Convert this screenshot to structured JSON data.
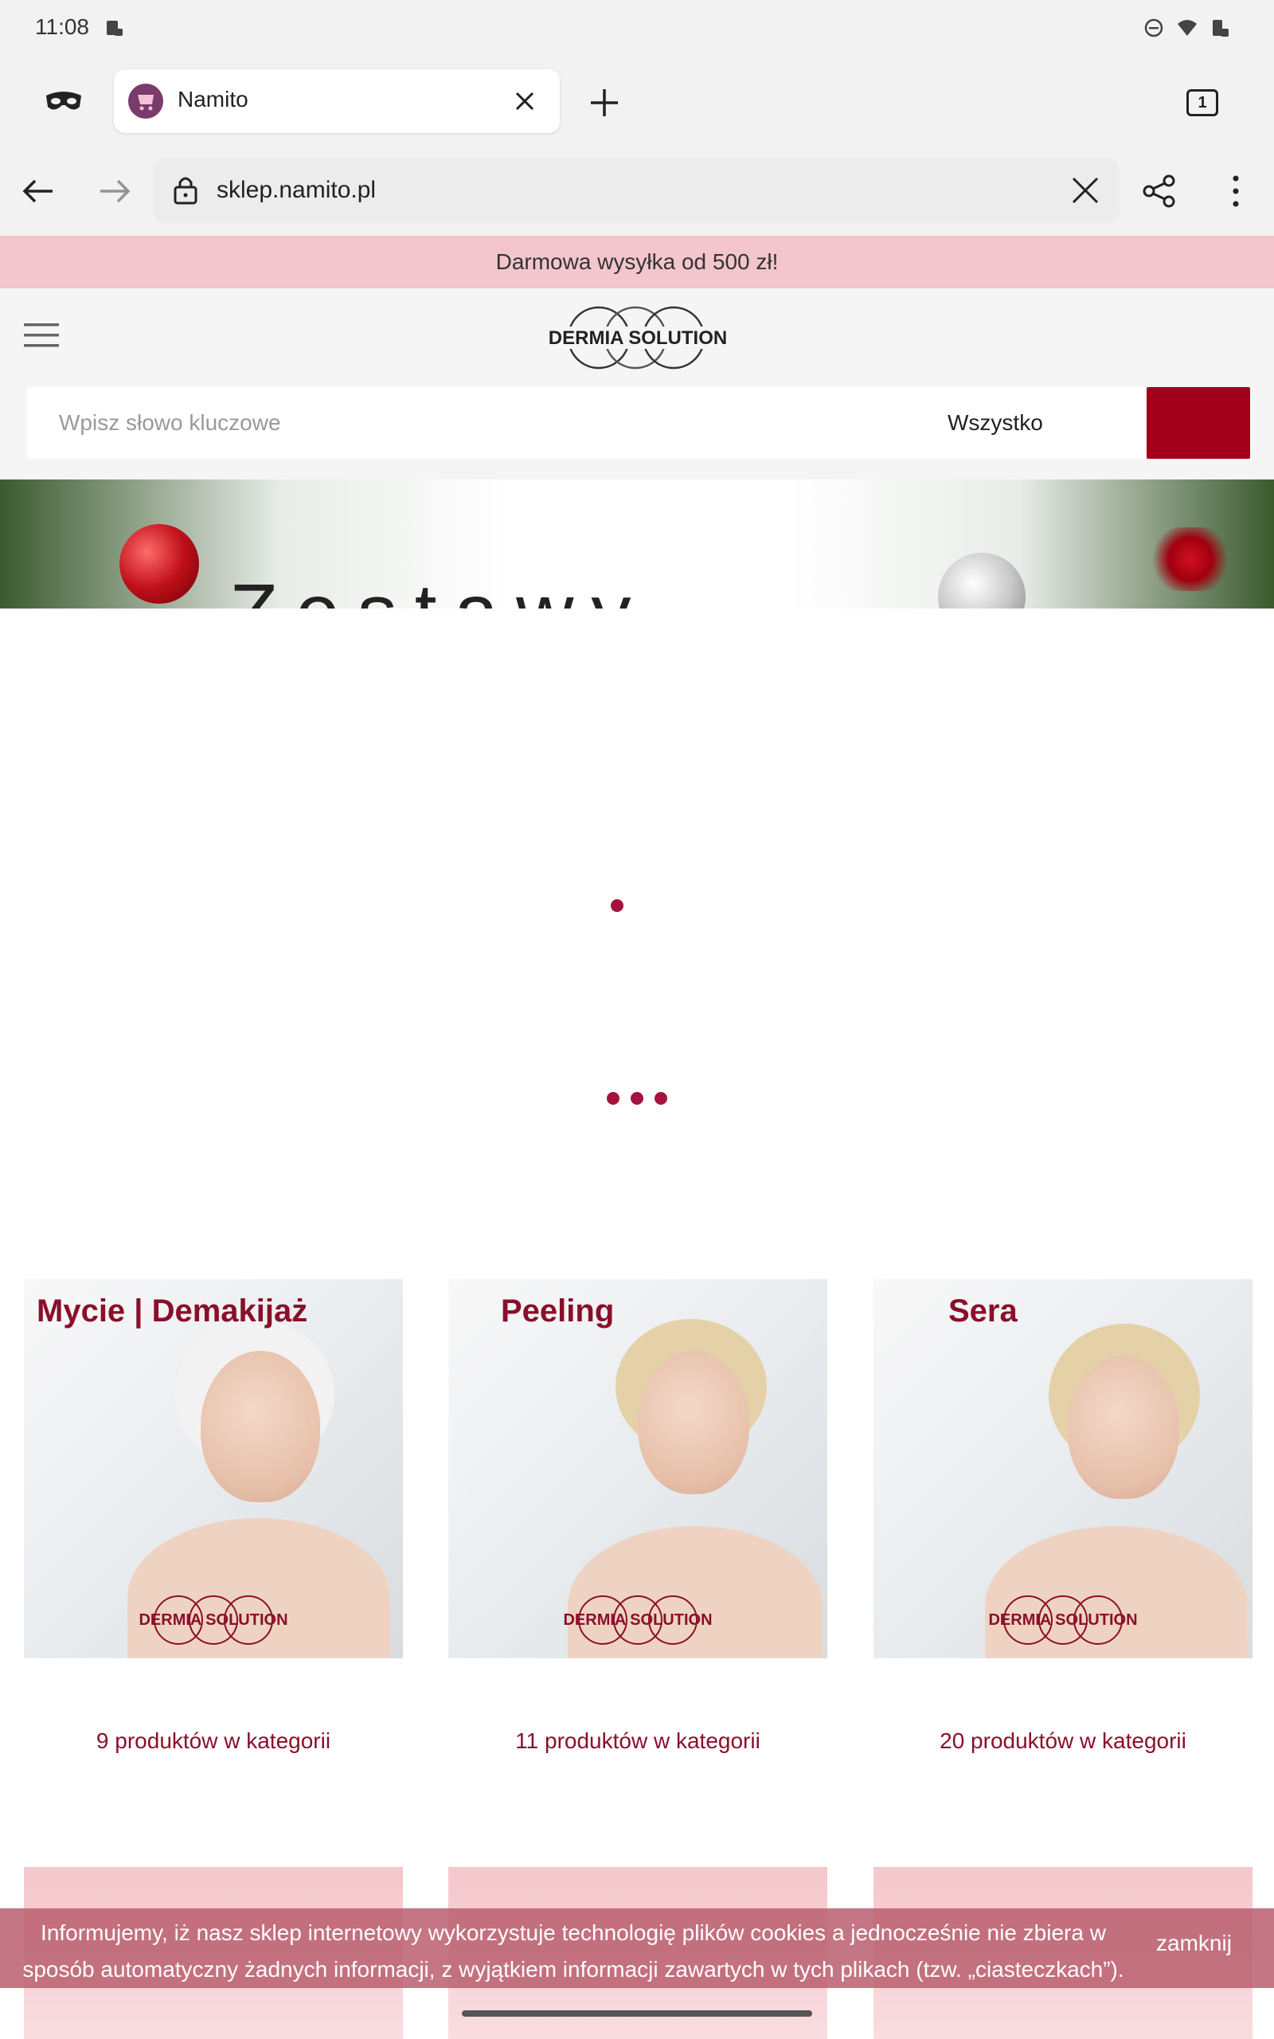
{
  "status_bar": {
    "time": "11:08"
  },
  "browser": {
    "tab": {
      "title": "Namito"
    },
    "tab_count": "1",
    "url": "sklep.namito.pl"
  },
  "page": {
    "promo_text": "Darmowa wysyłka od 500 zł!",
    "logo_text": "DERMIA SOLUTION",
    "search": {
      "placeholder": "Wpisz słowo kluczowe",
      "category": "Wszystko"
    },
    "hero_title": "Zestawy",
    "categories": [
      {
        "title": "Mycie | Demakijaż",
        "count": "9 produktów w kategorii"
      },
      {
        "title": "Peeling",
        "count": "11 produktów w kategorii"
      },
      {
        "title": "Sera",
        "count": "20 produktów w kategorii"
      }
    ],
    "cookie": {
      "text": "Informujemy, iż nasz sklep internetowy wykorzystuje technologię plików cookies a jednocześnie nie zbiera w sposób automatyczny żadnych informacji, z wyjątkiem informacji zawartych w tych plikach (tzw. „ciasteczkach”).",
      "close_label": "zamknij"
    }
  },
  "colors": {
    "brand_red": "#a3001b",
    "category_title": "#8a0f2a",
    "promo_bg": "#f2c6cc",
    "cookie_bg": "#ba6070"
  }
}
